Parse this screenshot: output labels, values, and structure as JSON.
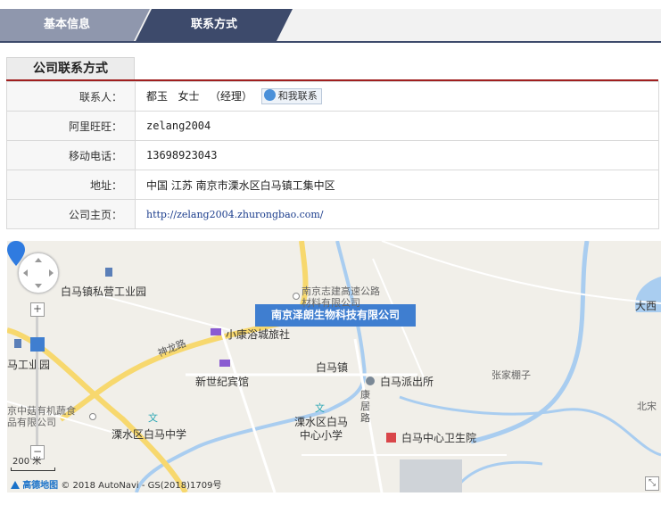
{
  "tabs": [
    {
      "label": "基本信息",
      "active": false
    },
    {
      "label": "联系方式",
      "active": true
    }
  ],
  "section_title": "公司联系方式",
  "contact": {
    "person": {
      "label": "联系人：",
      "name": "都玉",
      "salutation": "女士",
      "title": "（经理）",
      "chat_button": "和我联系"
    },
    "wangwang": {
      "label": "阿里旺旺：",
      "value": "zelang2004"
    },
    "mobile": {
      "label": "移动电话：",
      "value": "13698923043"
    },
    "address": {
      "label": "地址：",
      "value": "中国  江苏  南京市溧水区白马镇工集中区"
    },
    "homepage": {
      "label": "公司主页：",
      "value": "http://zelang2004.zhurongbao.com/"
    }
  },
  "map": {
    "poi_name": "南京泽朗生物科技有限公司",
    "labels": {
      "baima_industrial_park": "白马镇私营工业园",
      "zhijian": "南京志建高速公路材料有限公司",
      "xiaokang": "小康浴城旅社",
      "shenlong_road": "神龙路",
      "baima_town": "白马镇",
      "xinshiji": "新世纪宾馆",
      "police": "白马派出所",
      "zhangjia": "张家棚子",
      "daxi": "大西",
      "beizhuang": "北宋",
      "industrial_park_left": "马工业园",
      "food_company": "京中菇有机蔬食品有限公司",
      "kangju_road": "康居路",
      "lishui_middle": "溧水区白马中学",
      "primary_school": "溧水区白马中心小学",
      "health_center": "白马中心卫生院"
    },
    "scale_label": "200 米",
    "copyright_logo": "高德地图",
    "copyright_text": "© 2018 AutoNavi - GS(2018)1709号",
    "zoom_in": "+",
    "zoom_out": "−",
    "accent_color": "#3f7ed0",
    "road_color": "#f7d86e",
    "water_color": "#a9cdf0"
  }
}
